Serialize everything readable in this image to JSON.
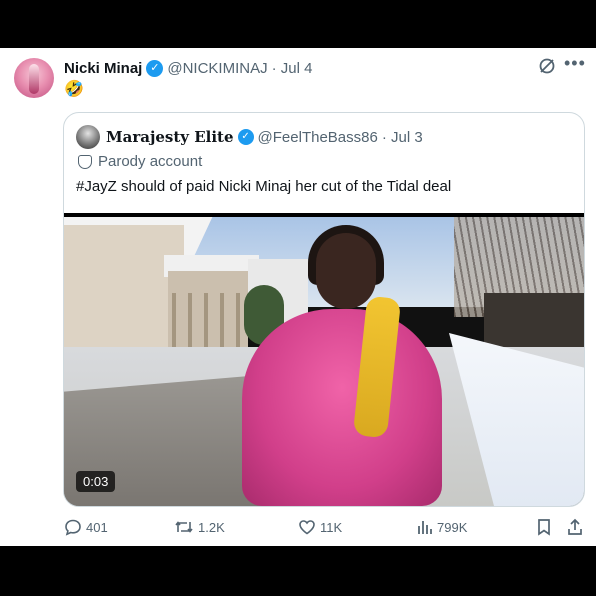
{
  "tweet": {
    "author_name": "Nicki Minaj",
    "author_handle": "@NICKIMINAJ",
    "date": "· Jul 4",
    "text": "🤣"
  },
  "quote": {
    "author_name": "Marajesty Elite",
    "author_handle": "@FeelTheBass86",
    "date": "· Jul 3",
    "label": "Parody account",
    "text": "#JayZ should of paid Nicki Minaj her cut of the Tidal deal",
    "video_duration": "0:03"
  },
  "actions": {
    "replies": "401",
    "retweets": "1.2K",
    "likes": "11K",
    "views": "799K"
  },
  "icons": [
    "reply-icon",
    "retweet-icon",
    "like-icon",
    "views-icon",
    "bookmark-icon",
    "share-icon",
    "grok-icon",
    "more-icon",
    "verified-icon",
    "parody-mask-icon"
  ],
  "colors": {
    "accent": "#1d9bf0",
    "muted": "#536471",
    "text": "#0f1419"
  }
}
